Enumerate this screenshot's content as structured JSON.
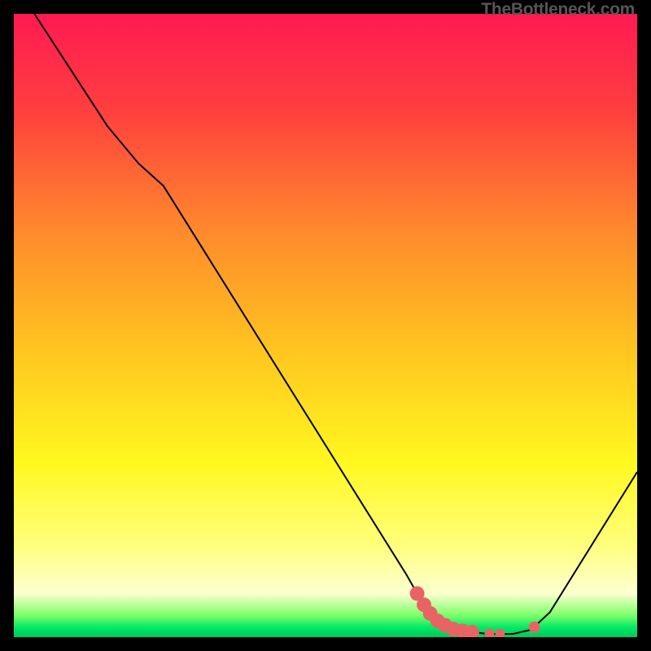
{
  "watermark": "TheBottleneck.com",
  "chart_data": {
    "type": "line",
    "title": "",
    "xlabel": "",
    "ylabel": "",
    "xlim": [
      0,
      100
    ],
    "ylim": [
      0,
      100
    ],
    "gradient_stops": [
      {
        "offset": 0,
        "color": "#ff1a52"
      },
      {
        "offset": 15,
        "color": "#ff3d3f"
      },
      {
        "offset": 35,
        "color": "#ff8a2c"
      },
      {
        "offset": 55,
        "color": "#ffc81f"
      },
      {
        "offset": 72,
        "color": "#fff81f"
      },
      {
        "offset": 85,
        "color": "#ffff7a"
      },
      {
        "offset": 93,
        "color": "#fdffd0"
      },
      {
        "offset": 96.5,
        "color": "#7cff6a"
      },
      {
        "offset": 98.5,
        "color": "#00e865"
      },
      {
        "offset": 100,
        "color": "#00c95e"
      }
    ],
    "series": [
      {
        "name": "bottleneck-curve",
        "color": "#000000",
        "points": [
          {
            "x": 3.3,
            "y": 100
          },
          {
            "x": 15.0,
            "y": 82.0
          },
          {
            "x": 20.0,
            "y": 76.0
          },
          {
            "x": 24.0,
            "y": 72.4
          },
          {
            "x": 63.0,
            "y": 10.0
          },
          {
            "x": 64.7,
            "y": 7.0
          },
          {
            "x": 67.0,
            "y": 3.5
          },
          {
            "x": 71.0,
            "y": 1.2
          },
          {
            "x": 76.0,
            "y": 0.5
          },
          {
            "x": 80.0,
            "y": 0.5
          },
          {
            "x": 83.0,
            "y": 1.2
          },
          {
            "x": 86.0,
            "y": 4.0
          },
          {
            "x": 100.0,
            "y": 26.5
          }
        ]
      }
    ],
    "markers": [
      {
        "x": 64.7,
        "y": 7.0,
        "color": "#e86464",
        "size": 9
      },
      {
        "x": 65.8,
        "y": 5.2,
        "color": "#e86464",
        "size": 9
      },
      {
        "x": 66.8,
        "y": 3.8,
        "color": "#e86464",
        "size": 9
      },
      {
        "x": 68.0,
        "y": 2.6,
        "color": "#e86464",
        "size": 9
      },
      {
        "x": 69.2,
        "y": 1.9,
        "color": "#e86464",
        "size": 9
      },
      {
        "x": 70.5,
        "y": 1.3,
        "color": "#e86464",
        "size": 9
      },
      {
        "x": 72.0,
        "y": 1.0,
        "color": "#e86464",
        "size": 9
      },
      {
        "x": 73.5,
        "y": 0.8,
        "color": "#e86464",
        "size": 9
      },
      {
        "x": 76.3,
        "y": 0.6,
        "color": "#e86464",
        "size": 6
      },
      {
        "x": 78.0,
        "y": 0.55,
        "color": "#e86464",
        "size": 6
      },
      {
        "x": 83.5,
        "y": 1.6,
        "color": "#e86464",
        "size": 7
      }
    ]
  }
}
